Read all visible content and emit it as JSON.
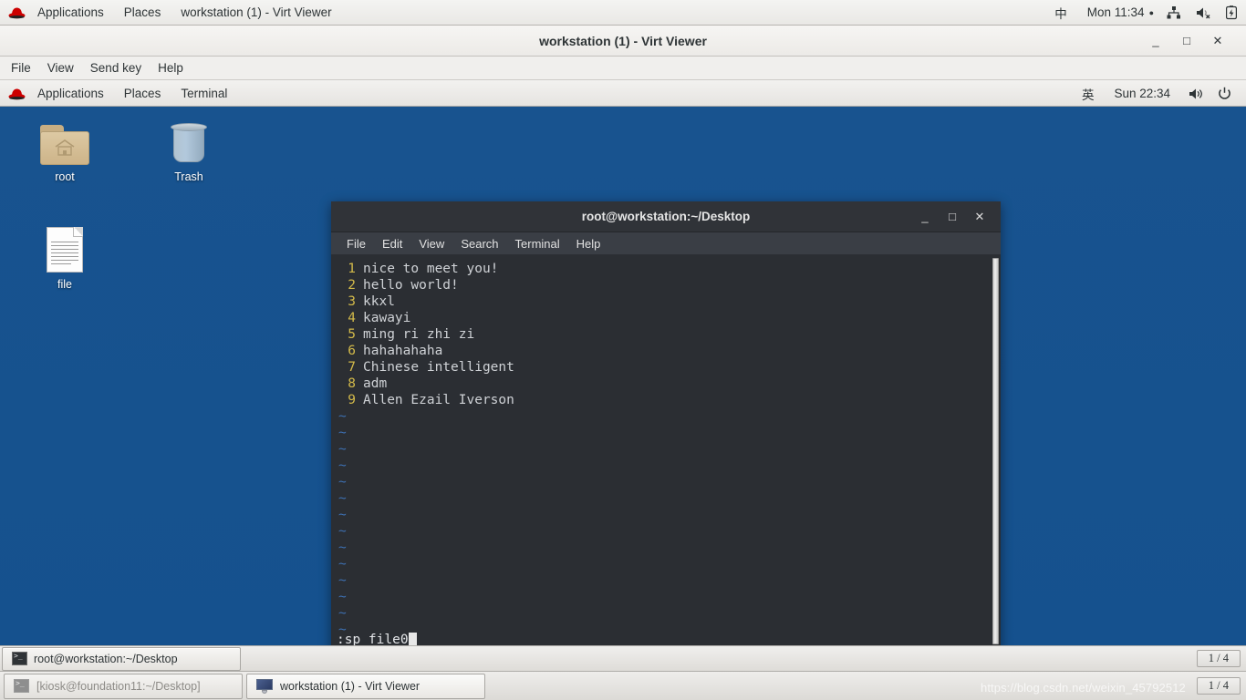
{
  "host": {
    "topbar": {
      "logo_icon": "redhat-icon",
      "applications_label": "Applications",
      "places_label": "Places",
      "window_label": "workstation (1) - Virt Viewer",
      "input_method": "中",
      "clock": "Mon 11:34",
      "clock_dot": "●",
      "network_icon": "network-wired-icon",
      "volume_icon": "volume-muted-icon",
      "battery_icon": "battery-charging-icon"
    },
    "taskbar": {
      "windows": [
        {
          "label": "[kiosk@foundation11:~/Desktop]",
          "icon": "terminal-icon",
          "active": false
        },
        {
          "label": "workstation (1) - Virt Viewer",
          "icon": "monitor-icon",
          "active": true
        }
      ],
      "workspace": "1 / 4"
    },
    "watermark": "https://blog.csdn.net/weixin_45792512"
  },
  "virt_viewer": {
    "title": "workstation (1) - Virt Viewer",
    "window_controls": {
      "minimize": "_",
      "maximize": "□",
      "close": "✕"
    },
    "menu": [
      "File",
      "View",
      "Send key",
      "Help"
    ]
  },
  "guest": {
    "topbar": {
      "logo_icon": "redhat-icon",
      "applications_label": "Applications",
      "places_label": "Places",
      "terminal_label": "Terminal",
      "input_method": "英",
      "clock": "Sun 22:34",
      "volume_icon": "volume-icon",
      "power_icon": "power-icon"
    },
    "desktop_icons": [
      {
        "label": "root",
        "icon": "home-folder-icon"
      },
      {
        "label": "Trash",
        "icon": "trash-icon"
      },
      {
        "label": "file",
        "icon": "text-file-icon"
      }
    ],
    "taskbar": {
      "windows": [
        {
          "label": "root@workstation:~/Desktop",
          "icon": "terminal-icon",
          "active": true
        }
      ],
      "workspace": "1 / 4"
    }
  },
  "terminal": {
    "title": "root@workstation:~/Desktop",
    "window_controls": {
      "minimize": "_",
      "maximize": "□",
      "close": "✕"
    },
    "menu": [
      "File",
      "Edit",
      "View",
      "Search",
      "Terminal",
      "Help"
    ],
    "vim": {
      "lines": [
        {
          "num": "1",
          "text": "nice to meet you!"
        },
        {
          "num": "2",
          "text": "hello world!"
        },
        {
          "num": "3",
          "text": "kkxl"
        },
        {
          "num": "4",
          "text": "kawayi"
        },
        {
          "num": "5",
          "text": "ming ri zhi zi"
        },
        {
          "num": "6",
          "text": "hahahahaha"
        },
        {
          "num": "7",
          "text": "Chinese intelligent"
        },
        {
          "num": "8",
          "text": "adm"
        },
        {
          "num": "9",
          "text": "Allen Ezail Iverson"
        }
      ],
      "empty_marker": "~",
      "empty_count": 14,
      "command_line": ":sp file0"
    },
    "colors": {
      "background": "#2b2e33",
      "text": "#cfd2d6",
      "line_number": "#d3ba4a",
      "tilde": "#3d6fb0",
      "titlebar": "#303338"
    }
  }
}
